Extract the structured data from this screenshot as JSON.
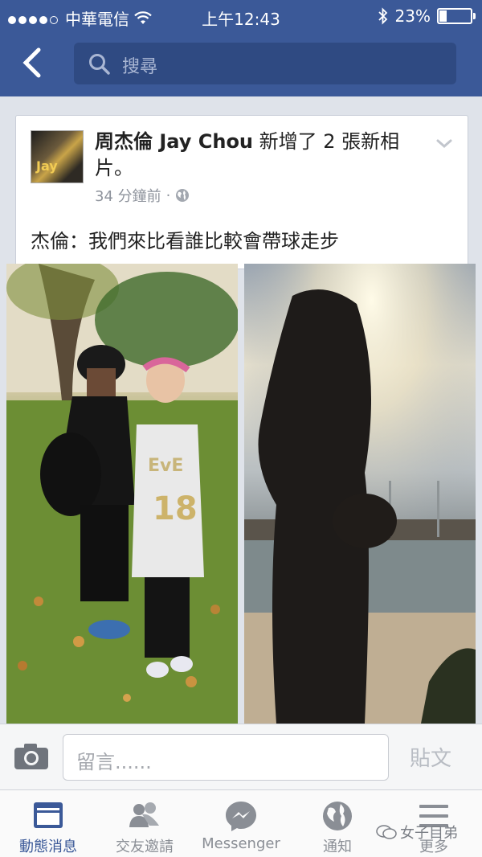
{
  "status_bar": {
    "carrier": "中華電信",
    "time": "上午12:43",
    "battery": "23%",
    "battery_level": 0.23
  },
  "search": {
    "placeholder": "搜尋"
  },
  "post": {
    "author": "周杰倫 Jay Chou",
    "action": "新增了 2 張新相片。",
    "time": "34 分鐘前",
    "separator": "·",
    "caption": "杰倫：我們來比看誰比較會帶球走步",
    "avatar_text": "Jay"
  },
  "photos": [
    {
      "name": "photo-left",
      "jersey_number": "18",
      "jersey_text": "EvE"
    },
    {
      "name": "photo-right"
    }
  ],
  "comment": {
    "placeholder": "留言......",
    "post_label": "貼文"
  },
  "tabs": [
    {
      "label": "動態消息",
      "icon": "news-feed-icon",
      "active": true
    },
    {
      "label": "交友邀請",
      "icon": "friends-icon",
      "active": false
    },
    {
      "label": "Messenger",
      "icon": "messenger-icon",
      "active": false
    },
    {
      "label": "通知",
      "icon": "globe-icon",
      "active": false
    },
    {
      "label": "更多",
      "icon": "menu-icon",
      "active": false
    }
  ],
  "watermark": "女子目弟",
  "colors": {
    "brand": "#3b5998",
    "active_tab": "#3b5998",
    "inactive": "#8a8e95"
  }
}
